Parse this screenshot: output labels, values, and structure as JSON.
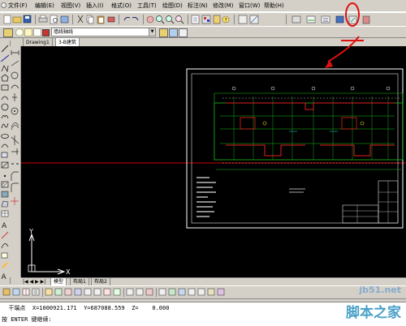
{
  "menu": [
    "文件(F)",
    "编辑(E)",
    "视图(V)",
    "插入(I)",
    "格式(O)",
    "工具(T)",
    "绘图(D)",
    "标注(N)",
    "修改(M)",
    "窗口(W)",
    "帮助(H)"
  ],
  "layer_toolbar": {
    "layer_value": "墙线轴线"
  },
  "drawing_tabs": [
    "Drawing1",
    "3-B建筑"
  ],
  "layout_tabs": [
    "模型",
    "布局1",
    "布局2"
  ],
  "ucs": {
    "x_label": "X",
    "y_label": "Y"
  },
  "command": {
    "coords_line": "  干端点  X=1000921.171  Y=687088.559  Z=    0.000",
    "prompt": "按 ENTER 键继续:"
  },
  "watermark": {
    "site": "jb51.net",
    "name": "脚本之家"
  },
  "colors": {
    "canvas": "#000000",
    "annotation": "#e01010",
    "crosshair": "#cc0000"
  }
}
